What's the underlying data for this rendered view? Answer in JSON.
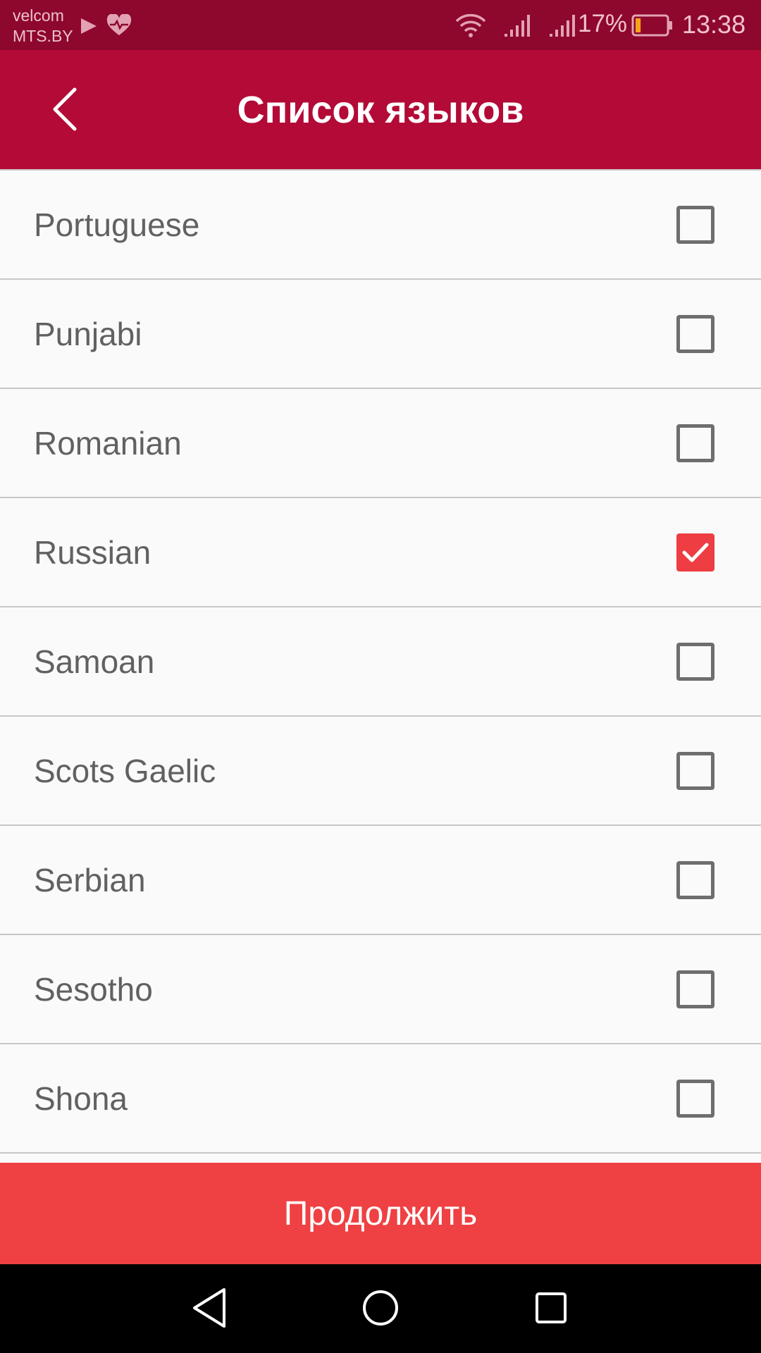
{
  "status_bar": {
    "carrier_line1": "velcom",
    "carrier_line2": "MTS.BY",
    "battery_percent": "17%",
    "time": "13:38",
    "battery_level": 0.17,
    "colors": {
      "background": "#8e072c",
      "battery_fill": "#f4a21a"
    }
  },
  "header": {
    "title": "Список языков",
    "back_icon": "chevron-left-icon",
    "color": "#b30a37"
  },
  "languages": [
    {
      "label": "Portuguese",
      "checked": false
    },
    {
      "label": "Punjabi",
      "checked": false
    },
    {
      "label": "Romanian",
      "checked": false
    },
    {
      "label": "Russian",
      "checked": true
    },
    {
      "label": "Samoan",
      "checked": false
    },
    {
      "label": "Scots Gaelic",
      "checked": false
    },
    {
      "label": "Serbian",
      "checked": false
    },
    {
      "label": "Sesotho",
      "checked": false
    },
    {
      "label": "Shona",
      "checked": false
    },
    {
      "label": "",
      "checked": false
    }
  ],
  "footer": {
    "continue_label": "Продолжить",
    "color": "#ef4043"
  },
  "navigation": {
    "back_icon": "triangle-back-icon",
    "home_icon": "circle-home-icon",
    "recents_icon": "square-recents-icon"
  }
}
